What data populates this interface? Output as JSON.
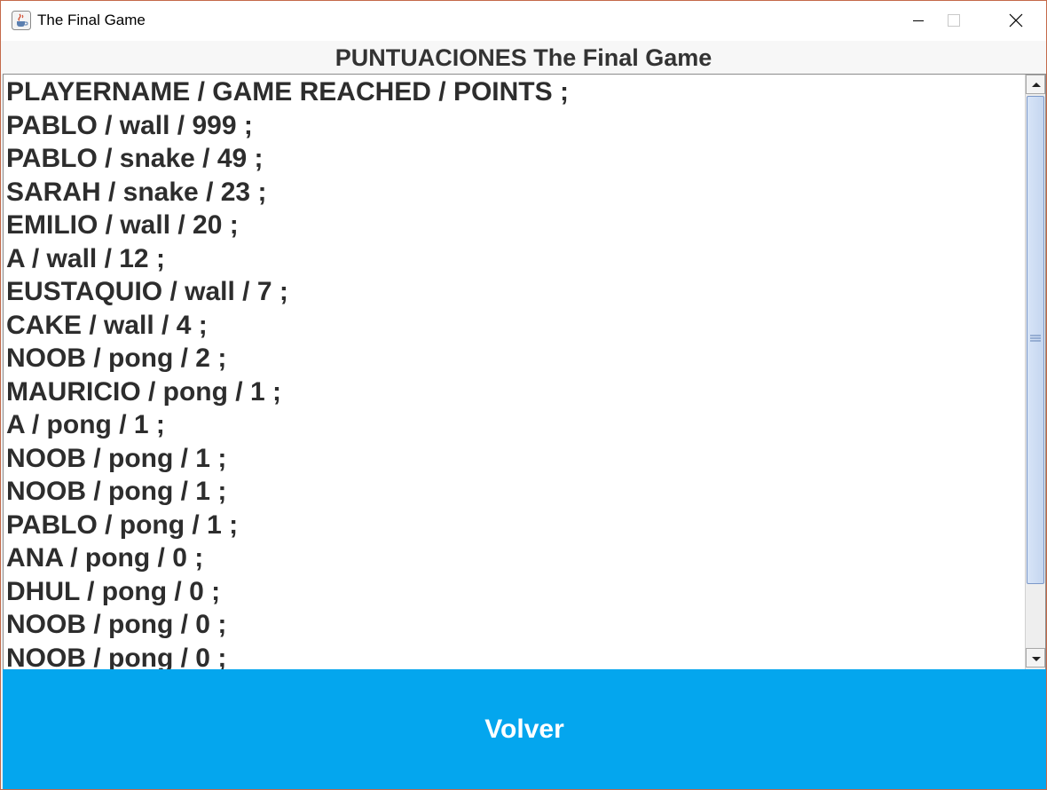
{
  "window": {
    "title": "The Final Game"
  },
  "heading": "PUNTUACIONES The Final Game",
  "scores": {
    "lines": [
      "PLAYERNAME / GAME REACHED / POINTS ;",
      "PABLO / wall / 999 ;",
      "PABLO / snake / 49 ;",
      "SARAH / snake / 23 ;",
      "EMILIO / wall / 20 ;",
      "A / wall / 12 ;",
      "EUSTAQUIO / wall / 7 ;",
      "CAKE / wall / 4 ;",
      "NOOB / pong / 2 ;",
      "MAURICIO / pong / 1 ;",
      "A / pong / 1 ;",
      "NOOB / pong / 1 ;",
      "NOOB / pong / 1 ;",
      "PABLO / pong / 1 ;",
      "ANA / pong / 0 ;",
      "DHUL / pong / 0 ;",
      "NOOB / pong / 0 ;",
      "NOOB / pong / 0 ;"
    ]
  },
  "volver_button": {
    "label": "Volver",
    "color": "#04a6ee"
  },
  "icons": {
    "app": "java-coffee-icon",
    "minimize": "minimize-icon",
    "maximize": "maximize-icon",
    "close": "close-icon",
    "scroll_up": "arrow-up-icon",
    "scroll_down": "arrow-down-icon"
  }
}
